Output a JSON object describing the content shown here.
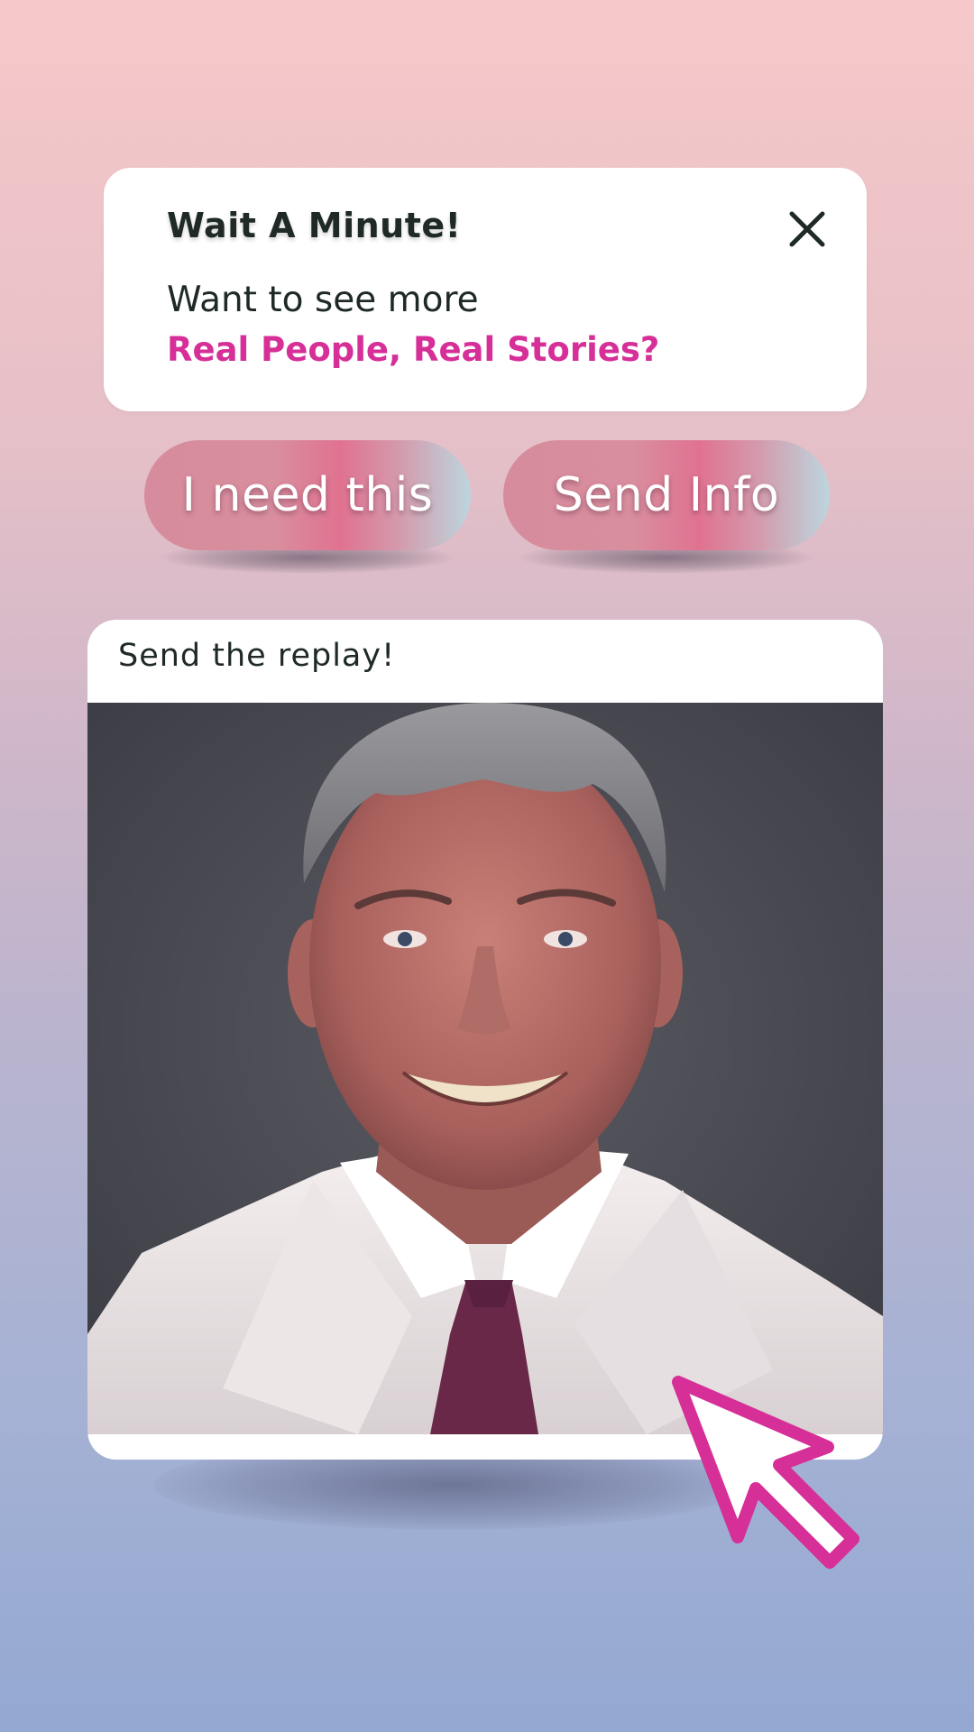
{
  "popup": {
    "title": "Wait A Minute!",
    "line1": "Want to see more",
    "line2": "Real People, Real Stories?",
    "close_icon": "close-icon",
    "accent_color": "#d62f97"
  },
  "buttons": [
    {
      "label": "I need this"
    },
    {
      "label": "Send Info"
    }
  ],
  "card": {
    "caption": "Send the replay!",
    "image_icon": "portrait-photo"
  },
  "cursor": {
    "icon": "pointer-cursor-icon",
    "color": "#d62f97"
  }
}
